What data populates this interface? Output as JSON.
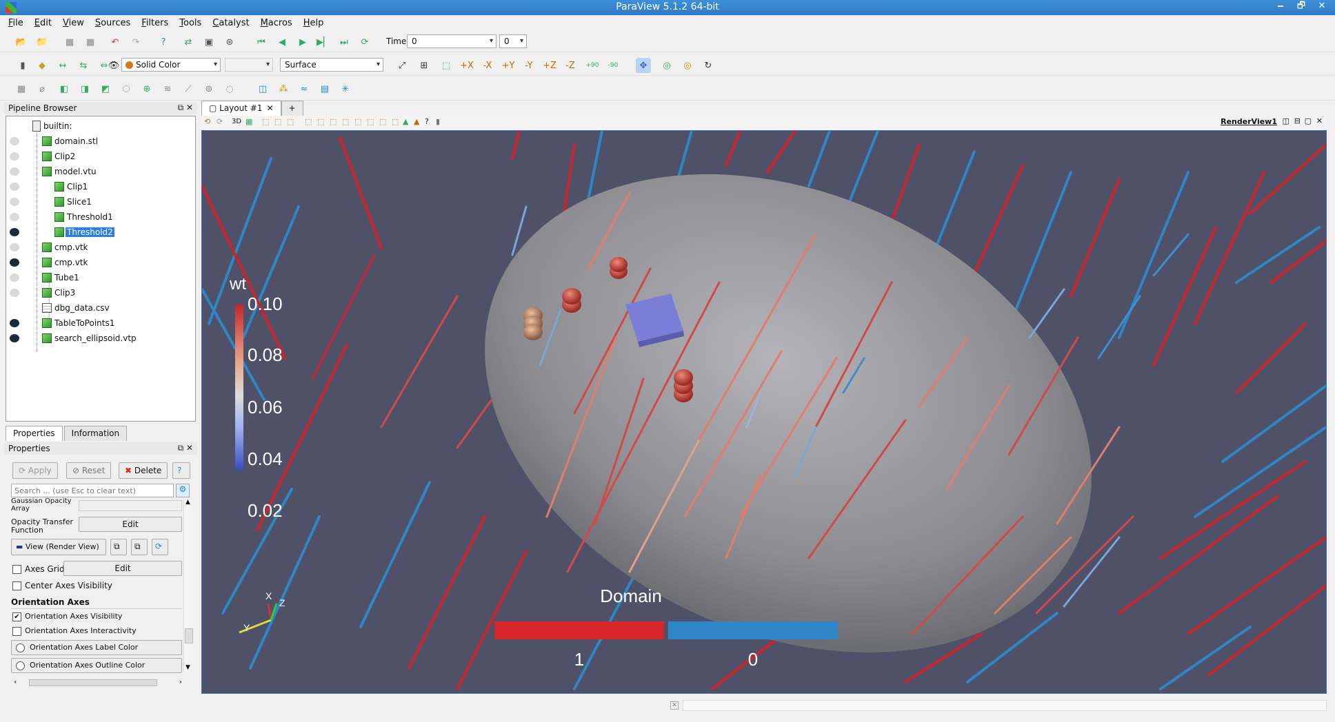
{
  "window": {
    "title": "ParaView 5.1.2 64-bit",
    "controls": [
      "🗕",
      "🗗",
      "✕"
    ]
  },
  "menu": [
    "File",
    "Edit",
    "View",
    "Sources",
    "Filters",
    "Tools",
    "Catalyst",
    "Macros",
    "Help"
  ],
  "toolbar": {
    "time_label": "Time:",
    "time_value": "0",
    "time_index": "0",
    "color_by": "Solid Color",
    "representation": "Surface",
    "cam_plus90": "+90",
    "cam_minus90": "-90"
  },
  "pipeline": {
    "title": "Pipeline Browser",
    "items": [
      {
        "label": "builtin:",
        "visible": null,
        "depth": 0
      },
      {
        "label": "domain.stl",
        "visible": false,
        "depth": 1
      },
      {
        "label": "Clip2",
        "visible": false,
        "depth": 1
      },
      {
        "label": "model.vtu",
        "visible": false,
        "depth": 1
      },
      {
        "label": "Clip1",
        "visible": false,
        "depth": 2
      },
      {
        "label": "Slice1",
        "visible": false,
        "depth": 2
      },
      {
        "label": "Threshold1",
        "visible": false,
        "depth": 2
      },
      {
        "label": "Threshold2",
        "visible": true,
        "depth": 2,
        "selected": true
      },
      {
        "label": "cmp.vtk",
        "visible": false,
        "depth": 1
      },
      {
        "label": "cmp.vtk",
        "visible": true,
        "depth": 1
      },
      {
        "label": "Tube1",
        "visible": false,
        "depth": 1
      },
      {
        "label": "Clip3",
        "visible": false,
        "depth": 1
      },
      {
        "label": "dbg_data.csv",
        "visible": null,
        "depth": 1
      },
      {
        "label": "TableToPoints1",
        "visible": true,
        "depth": 1
      },
      {
        "label": "search_ellipsoid.vtp",
        "visible": true,
        "depth": 1
      }
    ]
  },
  "panel_tabs": [
    "Properties",
    "Information"
  ],
  "properties": {
    "title": "Properties",
    "apply": "Apply",
    "reset": "Reset",
    "delete": "Delete",
    "help": "?",
    "search_placeholder": "Search ... (use Esc to clear text)",
    "gaussian_opacity": "Gaussian Opacity Array",
    "opacity_tf": "Opacity Transfer Function",
    "edit": "Edit",
    "view_label": "View (Render View)",
    "axes_grid": "Axes Grid",
    "axes_grid_edit": "Edit",
    "center_axes": "Center Axes Visibility",
    "section": "Orientation Axes",
    "oa_vis": "Orientation Axes Visibility",
    "oa_vis_checked": true,
    "oa_inter": "Orientation Axes Interactivity",
    "oa_label_color": "Orientation Axes Label Color",
    "oa_outline_color": "Orientation Axes Outline Color"
  },
  "layout": {
    "tab": "Layout #1",
    "add": "+",
    "view_name": "RenderView1",
    "mode_3d": "3D"
  },
  "render": {
    "colorbar_title": "wt",
    "colorbar_ticks": [
      "0.10",
      "0.08",
      "0.06",
      "0.04",
      "0.02"
    ],
    "domain_title": "Domain",
    "domain_labels": [
      "1",
      "0"
    ],
    "domain_colors": [
      "#d8262a",
      "#2f86c6"
    ],
    "axes_labels": [
      "X",
      "Y",
      "Z"
    ]
  }
}
